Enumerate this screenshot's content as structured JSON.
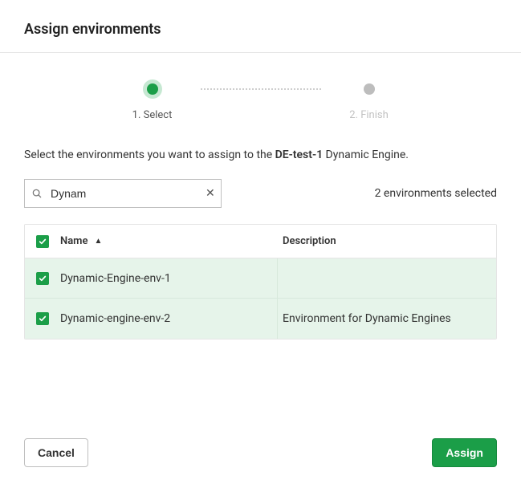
{
  "header": {
    "title": "Assign environments"
  },
  "stepper": {
    "step1": {
      "label": "1. Select",
      "active": true
    },
    "step2": {
      "label": "2. Finish",
      "active": false
    }
  },
  "instruction": {
    "prefix": "Select the environments you want to assign to the ",
    "engine_name": "DE-test-1",
    "suffix": " Dynamic Engine."
  },
  "search": {
    "value": "Dynam",
    "placeholder": "Search"
  },
  "selection_summary": "2 environments selected",
  "table": {
    "columns": {
      "name": "Name",
      "description": "Description"
    },
    "sort": {
      "column": "name",
      "dir": "asc"
    },
    "rows": [
      {
        "checked": true,
        "name": "Dynamic-Engine-env-1",
        "description": ""
      },
      {
        "checked": true,
        "name": "Dynamic-engine-env-2",
        "description": "Environment for Dynamic Engines"
      }
    ]
  },
  "footer": {
    "cancel": "Cancel",
    "assign": "Assign"
  }
}
